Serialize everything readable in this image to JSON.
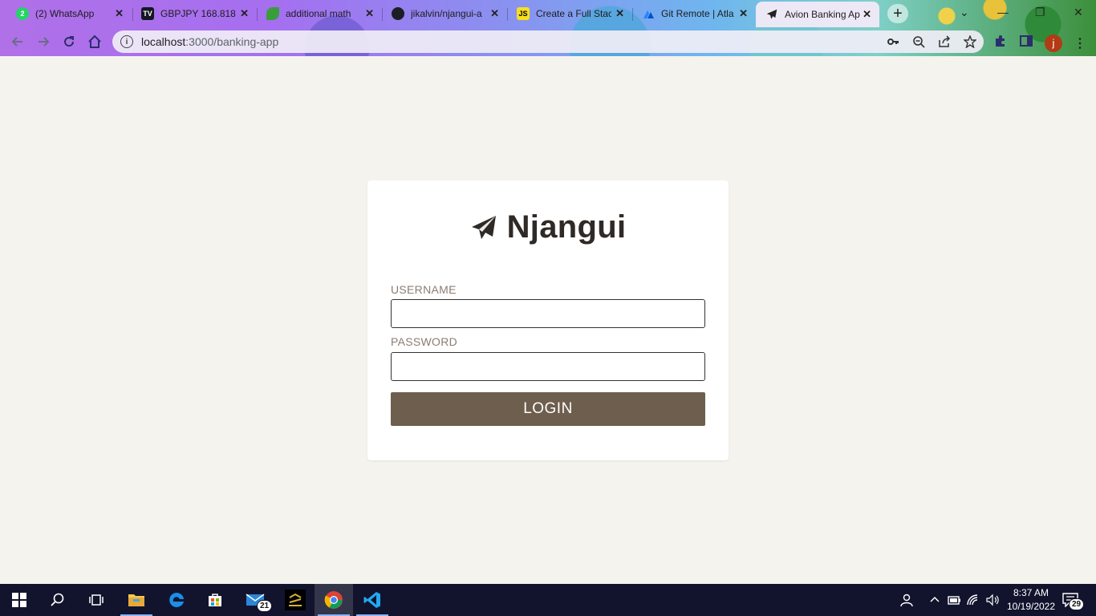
{
  "browser": {
    "tabs": [
      {
        "title": "(2) WhatsApp",
        "icon": "whatsapp-icon"
      },
      {
        "title": "GBPJPY 168.818",
        "icon": "tradingview-icon"
      },
      {
        "title": "additional math",
        "icon": "leaf-icon"
      },
      {
        "title": "jikalvin/njangui-a",
        "icon": "github-icon"
      },
      {
        "title": "Create a Full Stac",
        "icon": "js-icon"
      },
      {
        "title": "Git Remote | Atla",
        "icon": "atlassian-icon"
      },
      {
        "title": "Avion Banking Ap",
        "icon": "paper-plane-icon"
      }
    ],
    "active_tab": 6,
    "new_tab_label": "+",
    "url_host": "localhost",
    "url_rest": ":3000/banking-app",
    "avatar_letter": "j"
  },
  "app": {
    "brand_name": "Njangui",
    "username_label": "USERNAME",
    "username_value": "",
    "password_label": "PASSWORD",
    "password_value": "",
    "login_label": "LOGIN",
    "accent_color": "#6e5e4e",
    "background_color": "#f5f3ee"
  },
  "taskbar": {
    "mail_badge": "21",
    "notification_badge": "29",
    "time": "8:37 AM",
    "date": "10/19/2022"
  }
}
